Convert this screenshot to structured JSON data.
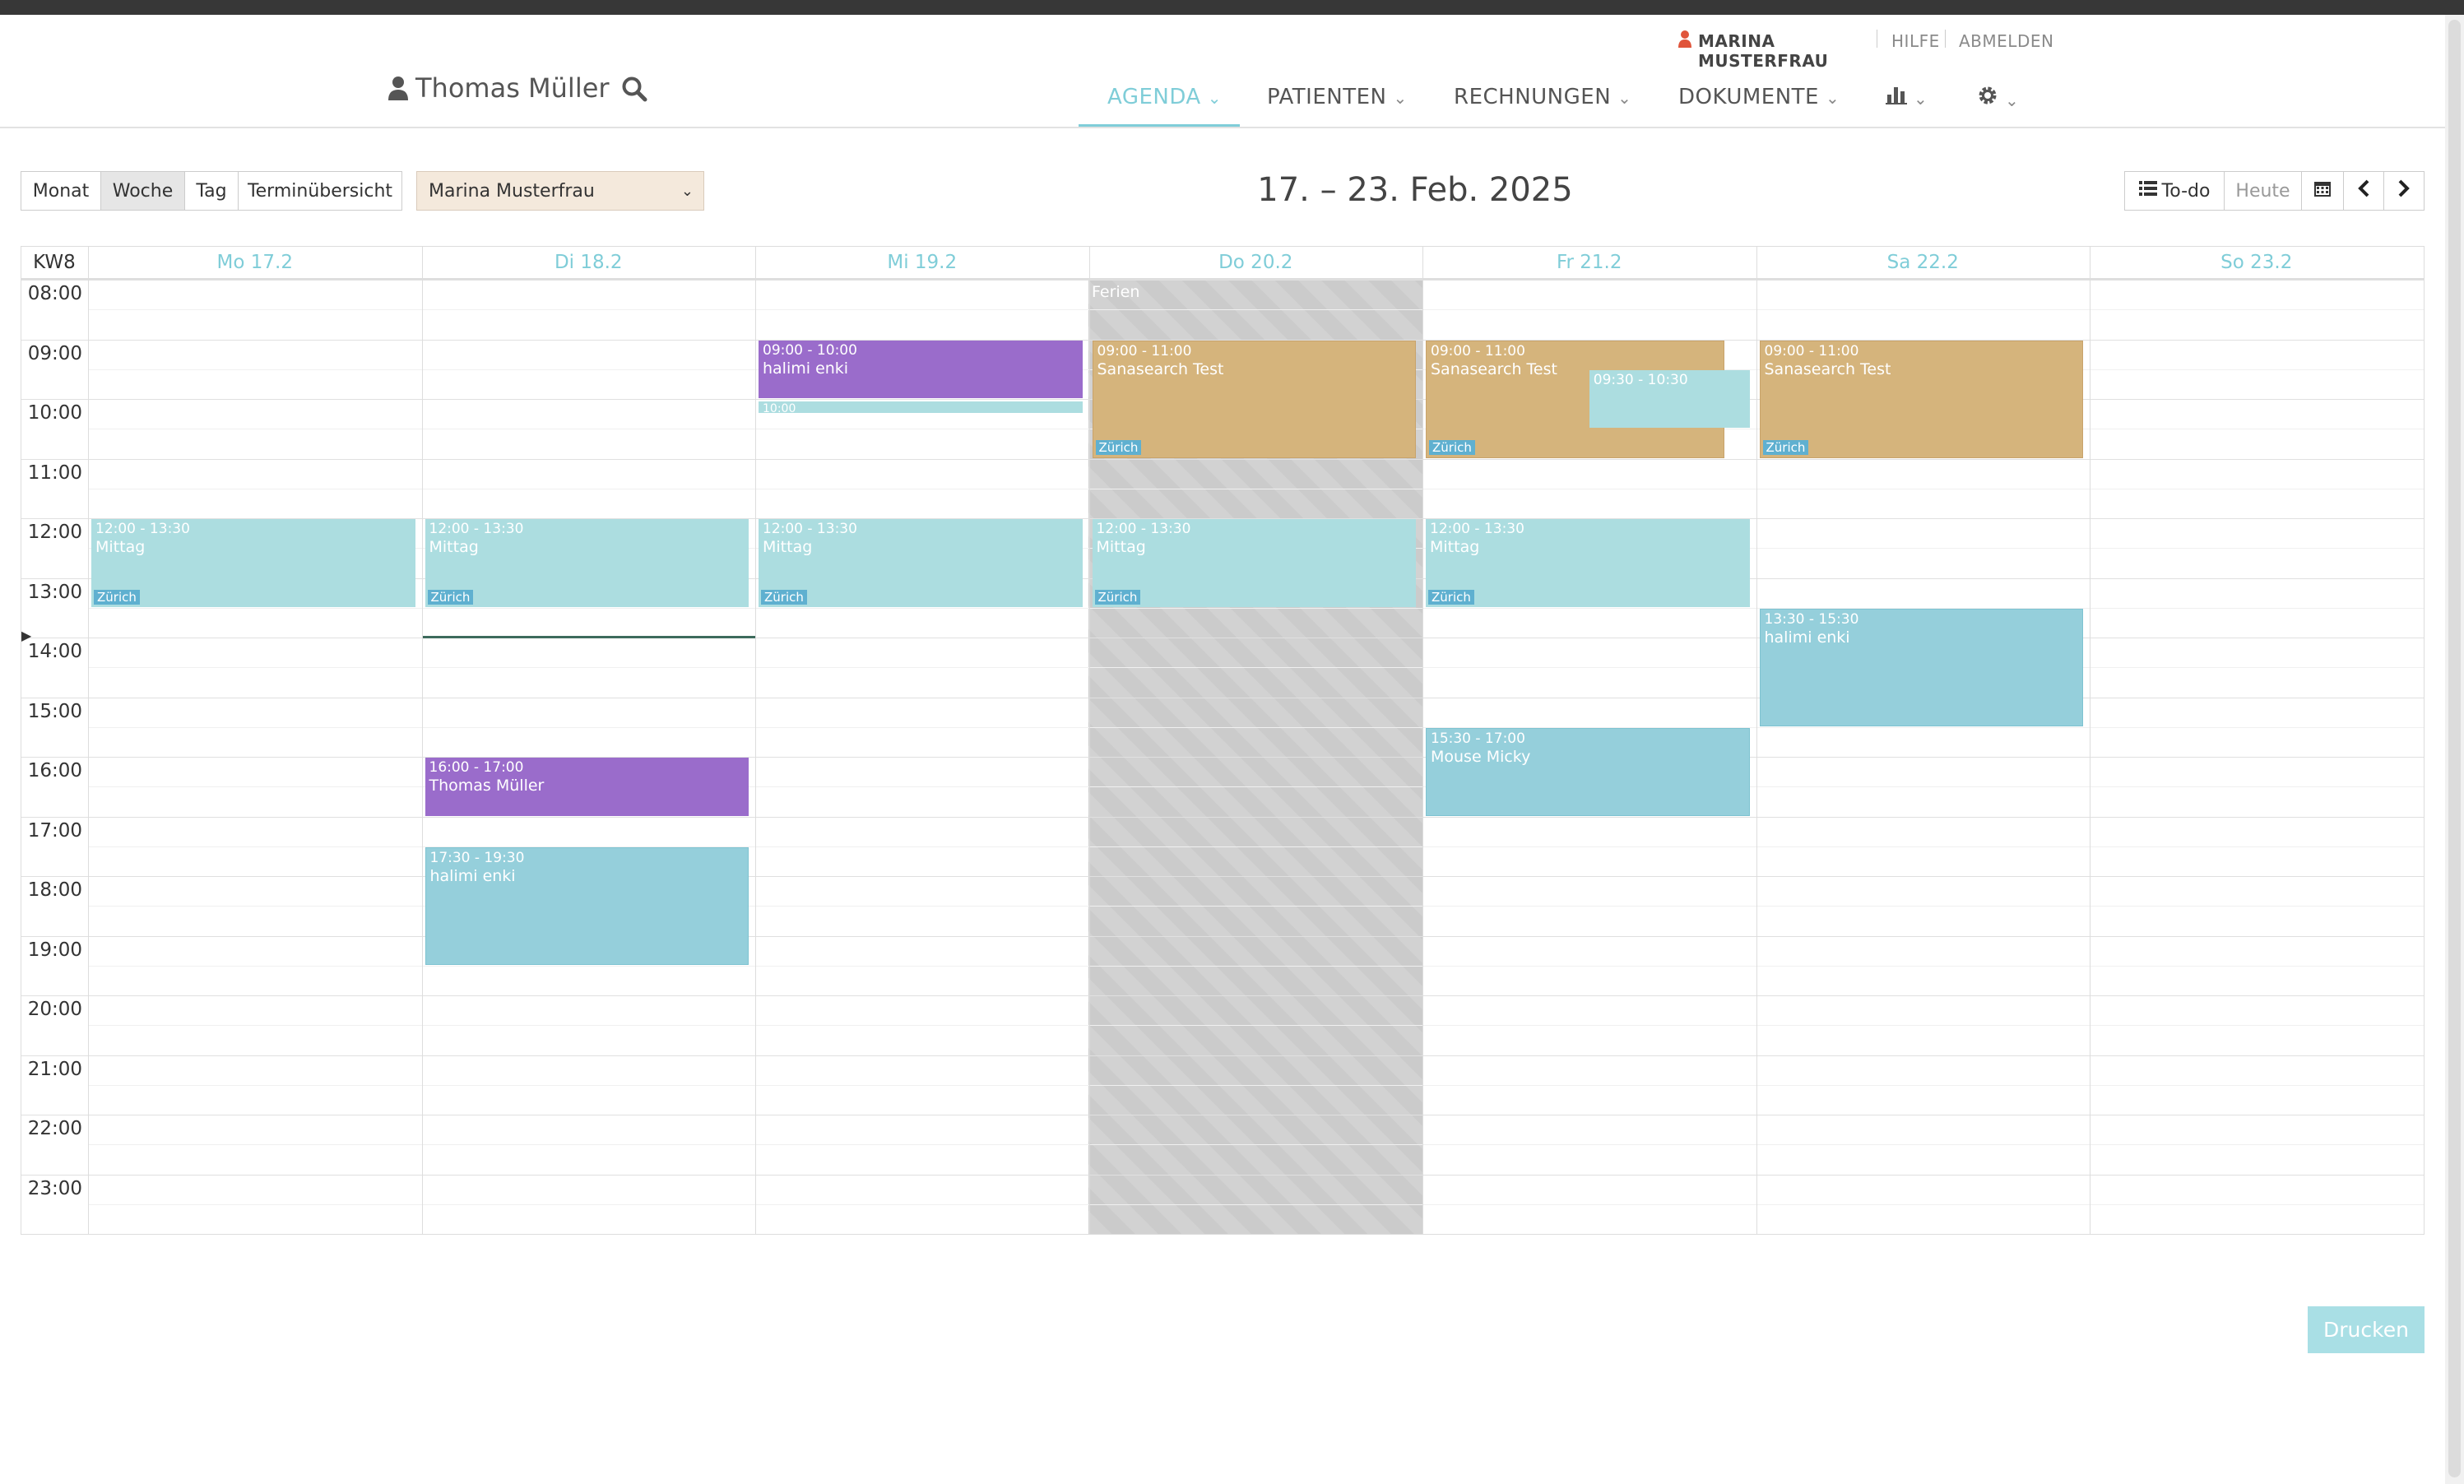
{
  "user_strip": {
    "user_name": "MARINA MUSTERFRAU",
    "help": "HILFE",
    "logout": "ABMELDEN",
    "user_icon": "user-icon"
  },
  "header": {
    "patient_name": "Thomas Müller",
    "patient_icon": "user-icon",
    "search_icon": "search-icon",
    "nav": {
      "agenda": "AGENDA",
      "patients": "PATIENTEN",
      "invoices": "RECHNUNGEN",
      "documents": "DOKUMENTE",
      "stats_icon": "bar-chart-icon",
      "settings_icon": "gear-icon"
    },
    "active_nav": "AGENDA",
    "accent_color": "#7fcdd8"
  },
  "toolbar": {
    "views": {
      "month": "Monat",
      "week": "Woche",
      "day": "Tag",
      "overview": "Terminübersicht"
    },
    "selected_view": "Woche",
    "agent_select": "Marina Musterfrau",
    "date_title": "17. – 23. Feb. 2025",
    "todo": "To-do",
    "todo_icon": "list-icon",
    "today": "Heute",
    "calendar_icon": "calendar-icon",
    "prev_icon": "chevron-left-icon",
    "next_icon": "chevron-right-icon"
  },
  "calendar": {
    "week_label": "KW8",
    "days": [
      "Mo 17.2",
      "Di 18.2",
      "Mi 19.2",
      "Do 20.2",
      "Fr 21.2",
      "Sa 22.2",
      "So 23.2"
    ],
    "hours": [
      "08:00",
      "09:00",
      "10:00",
      "11:00",
      "12:00",
      "13:00",
      "14:00",
      "15:00",
      "16:00",
      "17:00",
      "18:00",
      "19:00",
      "20:00",
      "21:00",
      "22:00",
      "23:00"
    ],
    "holiday": {
      "day": "Do 20.2",
      "label": "Ferien"
    },
    "current_time_marker": {
      "day": "Di 18.2",
      "time": "14:00"
    },
    "events": [
      {
        "day": "Mo 17.2",
        "time": "12:00 - 13:30",
        "title": "Mittag",
        "location": "Zürich",
        "color": "teal"
      },
      {
        "day": "Di 18.2",
        "time": "12:00 - 13:30",
        "title": "Mittag",
        "location": "Zürich",
        "color": "teal"
      },
      {
        "day": "Di 18.2",
        "time": "16:00 - 17:00",
        "title": "Thomas Müller",
        "location": "",
        "color": "purple"
      },
      {
        "day": "Di 18.2",
        "time": "17:30 - 19:30",
        "title": "halimi enki",
        "location": "",
        "color": "blue"
      },
      {
        "day": "Mi 19.2",
        "time": "09:00 - 10:00",
        "title": "halimi enki",
        "location": "",
        "color": "purple"
      },
      {
        "day": "Mi 19.2",
        "time": "10:00",
        "title": "",
        "location": "",
        "color": "teal"
      },
      {
        "day": "Mi 19.2",
        "time": "12:00 - 13:30",
        "title": "Mittag",
        "location": "Zürich",
        "color": "teal"
      },
      {
        "day": "Do 20.2",
        "time": "09:00 - 11:00",
        "title": "Sanasearch Test",
        "location": "Zürich",
        "color": "tan"
      },
      {
        "day": "Do 20.2",
        "time": "12:00 - 13:30",
        "title": "Mittag",
        "location": "Zürich",
        "color": "teal"
      },
      {
        "day": "Fr 21.2",
        "time": "09:00 - 11:00",
        "title": "Sanasearch Test",
        "location": "Zürich",
        "color": "tan"
      },
      {
        "day": "Fr 21.2",
        "time": "09:30 - 10:30",
        "title": "",
        "location": "",
        "color": "teal"
      },
      {
        "day": "Fr 21.2",
        "time": "12:00 - 13:30",
        "title": "Mittag",
        "location": "Zürich",
        "color": "teal"
      },
      {
        "day": "Fr 21.2",
        "time": "15:30 - 17:00",
        "title": "Mouse Micky",
        "location": "",
        "color": "blue"
      },
      {
        "day": "Sa 22.2",
        "time": "09:00 - 11:00",
        "title": "Sanasearch Test",
        "location": "Zürich",
        "color": "tan"
      },
      {
        "day": "Sa 22.2",
        "time": "13:30 - 15:30",
        "title": "halimi enki",
        "location": "",
        "color": "blue"
      }
    ],
    "event_colors": {
      "teal": "#acdde0",
      "purple": "#9a6ccb",
      "tan": "#d5b47c",
      "blue": "#95cfdb"
    }
  },
  "footer": {
    "print": "Drucken"
  }
}
